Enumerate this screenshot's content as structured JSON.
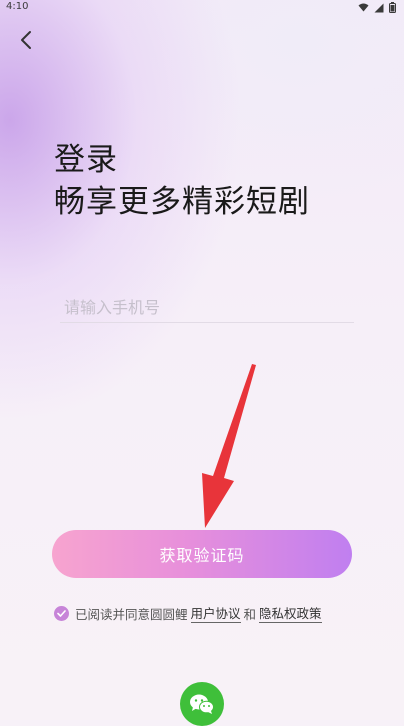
{
  "status_bar": {
    "time": "4:10",
    "icons": [
      "wifi-icon",
      "signal-icon",
      "battery-icon"
    ]
  },
  "nav": {
    "back_icon": "chevron-left-icon"
  },
  "header": {
    "title_line1": "登录",
    "title_line2": "畅享更多精彩短剧"
  },
  "form": {
    "phone_placeholder": "请输入手机号",
    "phone_value": "",
    "submit_label": "获取验证码"
  },
  "agreement": {
    "checked": true,
    "prefix": "已阅读并同意圆圆鲤",
    "user_agreement": "用户协议",
    "connector": "和",
    "privacy_policy": "隐私权政策"
  },
  "social_login": {
    "wechat_icon": "wechat-icon"
  },
  "colors": {
    "button_gradient_start": "#f7a4cf",
    "button_gradient_end": "#c07ff0",
    "checkbox": "#c784d8",
    "arrow": "#e8343a",
    "wechat": "#3fbf3a"
  }
}
